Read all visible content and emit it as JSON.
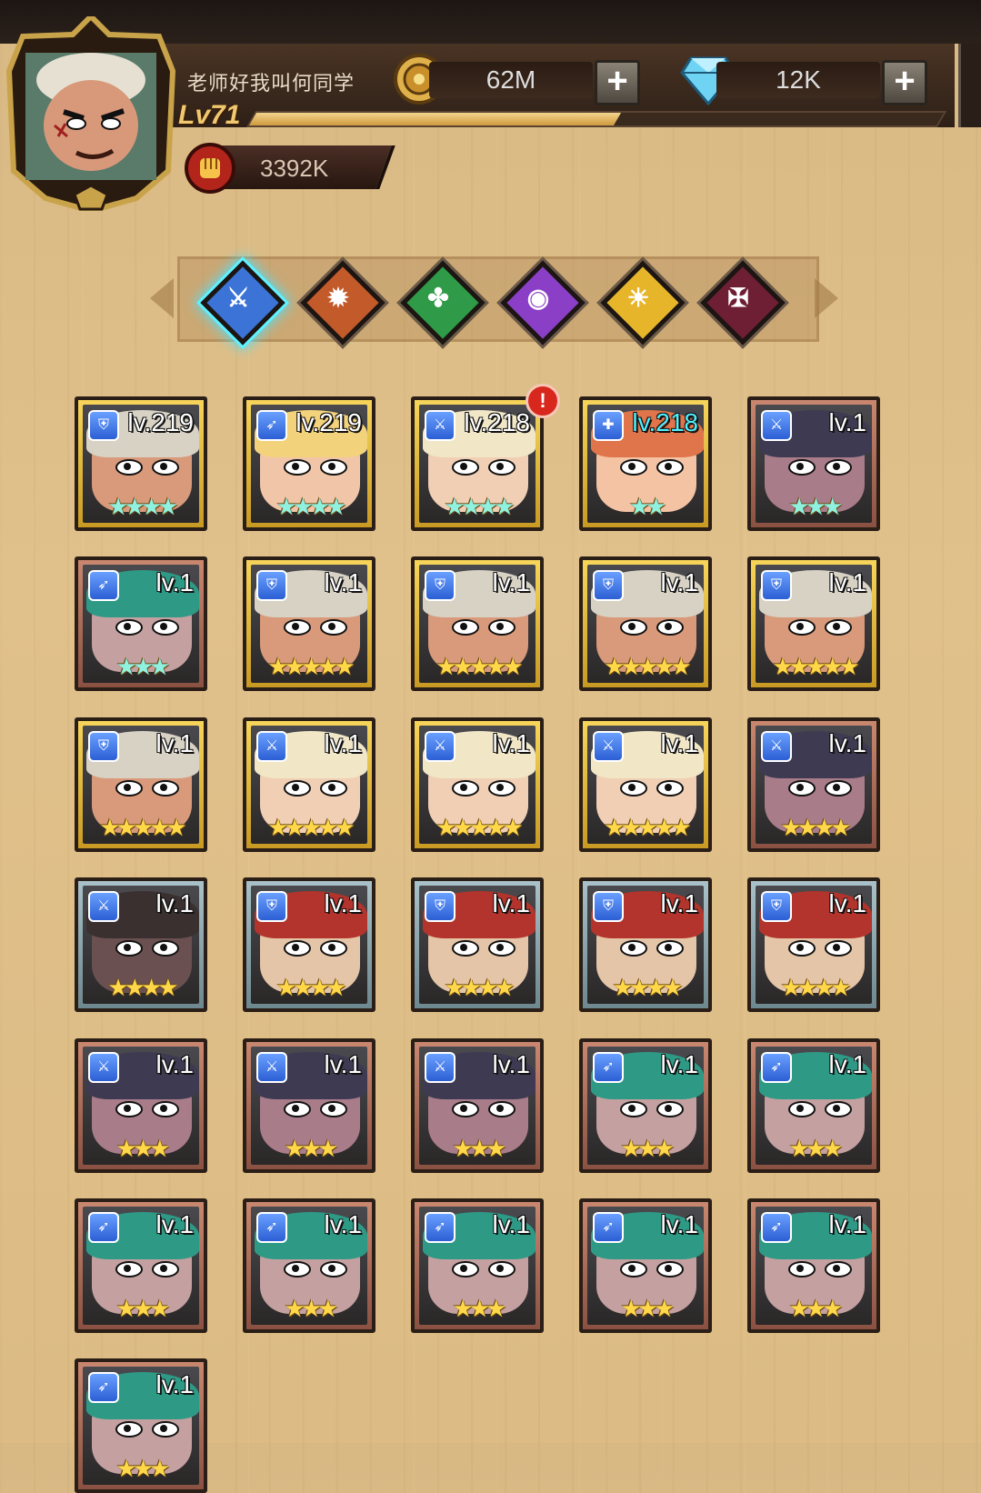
{
  "player": {
    "name": "老师好我叫何同学",
    "level": "Lv71",
    "xp_fraction": 0.53,
    "power": "3392K"
  },
  "resources": {
    "gold": "62M",
    "diamonds": "12K"
  },
  "factions": [
    {
      "icon": "human-faction-icon",
      "color": "#3b74d6",
      "active": true
    },
    {
      "icon": "orc-faction-icon",
      "color": "#c25a2a",
      "active": false
    },
    {
      "icon": "nature-faction-icon",
      "color": "#2f9a47",
      "active": false
    },
    {
      "icon": "arcane-faction-icon",
      "color": "#8a3fc6",
      "active": false
    },
    {
      "icon": "light-faction-icon",
      "color": "#e6b52a",
      "active": false
    },
    {
      "icon": "dark-faction-icon",
      "color": "#6e1f34",
      "active": false
    }
  ],
  "alert_badge": "!",
  "heroes": [
    {
      "level": "lv.219",
      "stars": 4,
      "frame": "gold",
      "star_color": "teal",
      "class": "shield",
      "hair": "#d8d2c4",
      "skin": "#d89a7a",
      "level_color": "white"
    },
    {
      "level": "lv.219",
      "stars": 4,
      "frame": "gold",
      "star_color": "teal",
      "class": "bow",
      "hair": "#f3d27c",
      "skin": "#f1c6a8",
      "level_color": "white"
    },
    {
      "level": "lv.218",
      "stars": 4,
      "frame": "gold",
      "star_color": "teal",
      "class": "sword",
      "hair": "#f1e6c6",
      "skin": "#f1cfb4",
      "level_color": "white"
    },
    {
      "level": "lv.218",
      "stars": 2,
      "frame": "gold",
      "star_color": "teal",
      "class": "heal",
      "hair": "#e0744a",
      "skin": "#f4c3a4",
      "level_color": "cyan"
    },
    {
      "level": "lv.1",
      "stars": 3,
      "frame": "bronze",
      "star_color": "teal",
      "class": "sword",
      "hair": "#3e3a52",
      "skin": "#a97c8a",
      "level_color": "white"
    },
    {
      "level": "lv.1",
      "stars": 3,
      "frame": "bronze",
      "star_color": "teal",
      "class": "bow",
      "hair": "#2e9a86",
      "skin": "#c4a0a0",
      "level_color": "white"
    },
    {
      "level": "lv.1",
      "stars": 5,
      "frame": "gold",
      "star_color": "gold",
      "class": "shield",
      "hair": "#d8d2c4",
      "skin": "#d89a7a",
      "level_color": "white"
    },
    {
      "level": "lv.1",
      "stars": 5,
      "frame": "gold",
      "star_color": "gold",
      "class": "shield",
      "hair": "#d8d2c4",
      "skin": "#d89a7a",
      "level_color": "white"
    },
    {
      "level": "lv.1",
      "stars": 5,
      "frame": "gold",
      "star_color": "gold",
      "class": "shield",
      "hair": "#d8d2c4",
      "skin": "#d89a7a",
      "level_color": "white"
    },
    {
      "level": "lv.1",
      "stars": 5,
      "frame": "gold",
      "star_color": "gold",
      "class": "shield",
      "hair": "#d8d2c4",
      "skin": "#d89a7a",
      "level_color": "white"
    },
    {
      "level": "lv.1",
      "stars": 5,
      "frame": "gold",
      "star_color": "gold",
      "class": "shield",
      "hair": "#d8d2c4",
      "skin": "#d89a7a",
      "level_color": "white"
    },
    {
      "level": "lv.1",
      "stars": 5,
      "frame": "gold",
      "star_color": "gold",
      "class": "sword",
      "hair": "#f1e6c6",
      "skin": "#f1cfb4",
      "level_color": "white"
    },
    {
      "level": "lv.1",
      "stars": 5,
      "frame": "gold",
      "star_color": "gold",
      "class": "sword",
      "hair": "#f1e6c6",
      "skin": "#f1cfb4",
      "level_color": "white"
    },
    {
      "level": "lv.1",
      "stars": 5,
      "frame": "gold",
      "star_color": "gold",
      "class": "sword",
      "hair": "#f1e6c6",
      "skin": "#f1cfb4",
      "level_color": "white"
    },
    {
      "level": "lv.1",
      "stars": 4,
      "frame": "bronze",
      "star_color": "gold",
      "class": "sword",
      "hair": "#3e3a52",
      "skin": "#a97c8a",
      "level_color": "white"
    },
    {
      "level": "lv.1",
      "stars": 4,
      "frame": "silver",
      "star_color": "gold",
      "class": "sword",
      "hair": "#3a3030",
      "skin": "#6a5050",
      "level_color": "white"
    },
    {
      "level": "lv.1",
      "stars": 4,
      "frame": "silver",
      "star_color": "gold",
      "class": "shield",
      "hair": "#b2342c",
      "skin": "#e5c5a8",
      "level_color": "white"
    },
    {
      "level": "lv.1",
      "stars": 4,
      "frame": "silver",
      "star_color": "gold",
      "class": "shield",
      "hair": "#b2342c",
      "skin": "#e5c5a8",
      "level_color": "white"
    },
    {
      "level": "lv.1",
      "stars": 4,
      "frame": "silver",
      "star_color": "gold",
      "class": "shield",
      "hair": "#b2342c",
      "skin": "#e5c5a8",
      "level_color": "white"
    },
    {
      "level": "lv.1",
      "stars": 4,
      "frame": "silver",
      "star_color": "gold",
      "class": "shield",
      "hair": "#b2342c",
      "skin": "#e5c5a8",
      "level_color": "white"
    },
    {
      "level": "lv.1",
      "stars": 3,
      "frame": "bronze",
      "star_color": "gold",
      "class": "sword",
      "hair": "#3e3a52",
      "skin": "#a97c8a",
      "level_color": "white"
    },
    {
      "level": "lv.1",
      "stars": 3,
      "frame": "bronze",
      "star_color": "gold",
      "class": "sword",
      "hair": "#3e3a52",
      "skin": "#a97c8a",
      "level_color": "white"
    },
    {
      "level": "lv.1",
      "stars": 3,
      "frame": "bronze",
      "star_color": "gold",
      "class": "sword",
      "hair": "#3e3a52",
      "skin": "#a97c8a",
      "level_color": "white"
    },
    {
      "level": "lv.1",
      "stars": 3,
      "frame": "bronze",
      "star_color": "gold",
      "class": "bow",
      "hair": "#2e9a86",
      "skin": "#c4a0a0",
      "level_color": "white"
    },
    {
      "level": "lv.1",
      "stars": 3,
      "frame": "bronze",
      "star_color": "gold",
      "class": "bow",
      "hair": "#2e9a86",
      "skin": "#c4a0a0",
      "level_color": "white"
    },
    {
      "level": "lv.1",
      "stars": 3,
      "frame": "bronze",
      "star_color": "gold",
      "class": "bow",
      "hair": "#2e9a86",
      "skin": "#c4a0a0",
      "level_color": "white"
    },
    {
      "level": "lv.1",
      "stars": 3,
      "frame": "bronze",
      "star_color": "gold",
      "class": "bow",
      "hair": "#2e9a86",
      "skin": "#c4a0a0",
      "level_color": "white"
    },
    {
      "level": "lv.1",
      "stars": 3,
      "frame": "bronze",
      "star_color": "gold",
      "class": "bow",
      "hair": "#2e9a86",
      "skin": "#c4a0a0",
      "level_color": "white"
    },
    {
      "level": "lv.1",
      "stars": 3,
      "frame": "bronze",
      "star_color": "gold",
      "class": "bow",
      "hair": "#2e9a86",
      "skin": "#c4a0a0",
      "level_color": "white"
    },
    {
      "level": "lv.1",
      "stars": 3,
      "frame": "bronze",
      "star_color": "gold",
      "class": "bow",
      "hair": "#2e9a86",
      "skin": "#c4a0a0",
      "level_color": "white"
    },
    {
      "level": "lv.1",
      "stars": 3,
      "frame": "bronze",
      "star_color": "gold",
      "class": "bow",
      "hair": "#2e9a86",
      "skin": "#c4a0a0",
      "level_color": "white"
    }
  ]
}
